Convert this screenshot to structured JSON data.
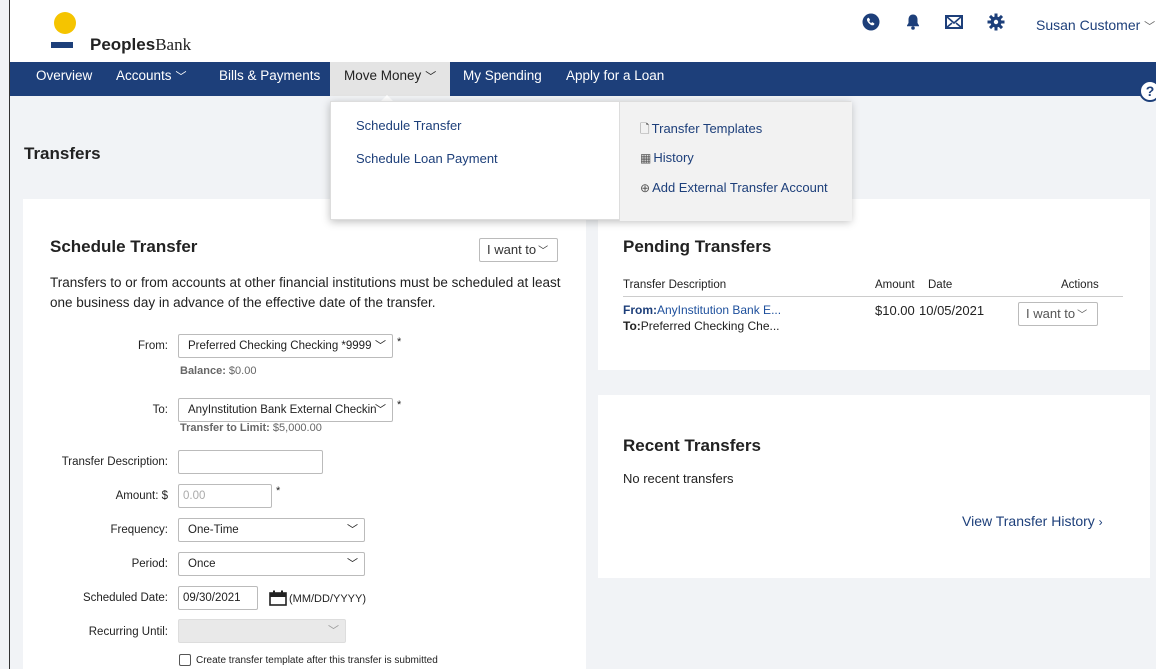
{
  "header": {
    "brand_bold": "Peoples",
    "brand_rest": "Bank",
    "user_name": "Susan Customer",
    "icons": [
      "phone-icon",
      "bell-icon",
      "envelope-icon",
      "gear-icon"
    ],
    "colors": {
      "primary": "#1d3f7a",
      "logo_sun": "#f5c400"
    }
  },
  "nav": {
    "items": [
      {
        "label": "Overview"
      },
      {
        "label": "Accounts",
        "has_dropdown": true
      },
      {
        "label": "Bills & Payments"
      },
      {
        "label": "Move Money",
        "has_dropdown": true,
        "active": true
      },
      {
        "label": "My Spending"
      },
      {
        "label": "Apply for a Loan"
      }
    ],
    "help_label": "?"
  },
  "menu": {
    "left": [
      "Schedule Transfer",
      "Schedule Loan Payment"
    ],
    "right": [
      {
        "icon": "document-icon",
        "label": "Transfer Templates"
      },
      {
        "icon": "calendar-icon",
        "label": "History"
      },
      {
        "icon": "plus-circle-icon",
        "label": "Add External Transfer Account"
      }
    ]
  },
  "page": {
    "title": "Transfers"
  },
  "schedule": {
    "title": "Schedule Transfer",
    "i_want_to": "I want to",
    "intro": "Transfers to or from accounts at other financial institutions must be scheduled at least one business day in advance of the effective date of the transfer.",
    "from_label": "From:",
    "from_value": "Preferred Checking Checking *9999",
    "balance_label": "Balance:",
    "balance_value": "$0.00",
    "to_label": "To:",
    "to_value": "AnyInstitution Bank External Checkin",
    "limit_label": "Transfer to Limit:",
    "limit_value": "$5,000.00",
    "description_label": "Transfer Description:",
    "description_value": "",
    "amount_label": "Amount: $",
    "amount_placeholder": "0.00",
    "frequency_label": "Frequency:",
    "frequency_value": "One-Time",
    "period_label": "Period:",
    "period_value": "Once",
    "date_label": "Scheduled Date:",
    "date_value": "09/30/2021",
    "date_format": "(MM/DD/YYYY)",
    "recurring_label": "Recurring Until:",
    "recurring_value": "",
    "template_checkbox_label": "Create transfer template after this transfer is submitted",
    "required_mark": "*"
  },
  "pending": {
    "title": "Pending Transfers",
    "columns": [
      "Transfer Description",
      "Amount",
      "Date",
      "Actions"
    ],
    "rows": [
      {
        "from_label": "From:",
        "from_value": "AnyInstitution Bank E...",
        "to_label": "To:",
        "to_value": "Preferred Checking Che...",
        "amount": "$10.00",
        "date": "10/05/2021",
        "action": "I want to"
      }
    ]
  },
  "recent": {
    "title": "Recent Transfers",
    "empty_text": "No recent transfers",
    "view_history": "View Transfer History"
  }
}
